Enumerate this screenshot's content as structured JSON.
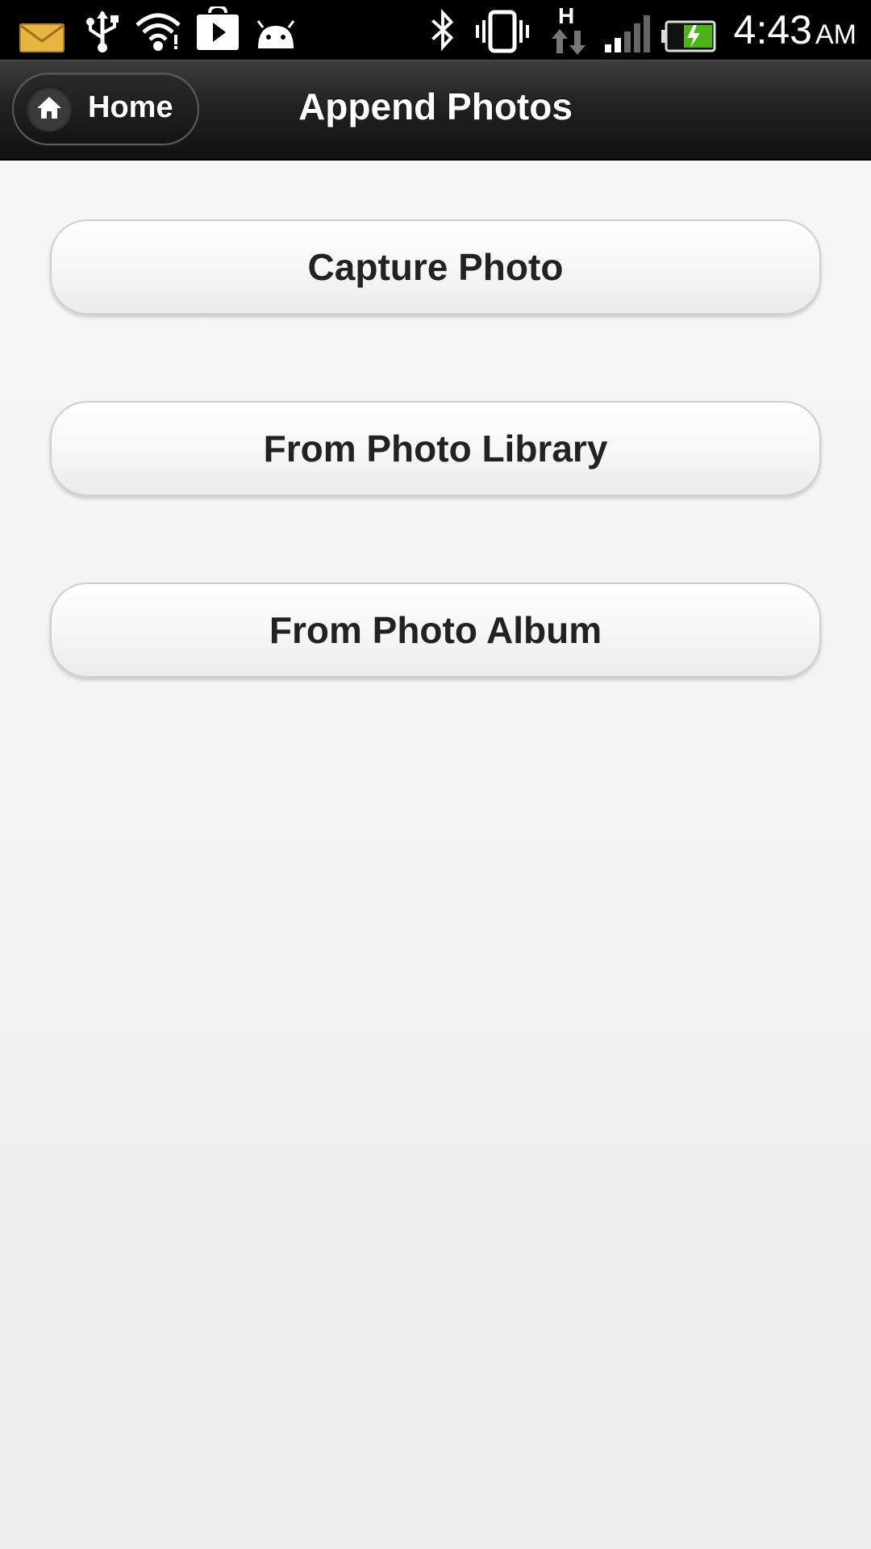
{
  "status_bar": {
    "time": "4:43",
    "ampm": "AM",
    "icons": [
      "mail-icon",
      "usb-icon",
      "wifi-icon",
      "play-store-icon",
      "android-icon",
      "bluetooth-icon",
      "vibrate-icon",
      "hspa-data-icon",
      "signal-icon",
      "battery-charging-icon"
    ],
    "network_type": "H"
  },
  "header": {
    "home_label": "Home",
    "title": "Append Photos"
  },
  "actions": {
    "capture_photo": "Capture Photo",
    "from_library": "From Photo Library",
    "from_album": "From Photo Album"
  },
  "colors": {
    "header_background": "#1a1a1a",
    "page_background": "#f3f3f3",
    "button_text": "#222222",
    "battery_fill": "#4cb516",
    "mail_icon": "#e8b540"
  }
}
